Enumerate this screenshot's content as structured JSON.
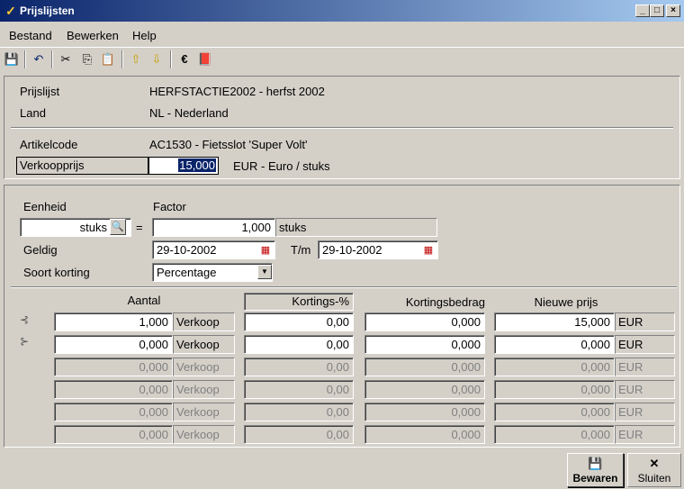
{
  "window": {
    "title": "Prijslijsten",
    "controls": [
      "_",
      "□",
      "×"
    ]
  },
  "menu": [
    "Bestand",
    "Bewerken",
    "Help"
  ],
  "toolbar": {
    "icons": [
      "save-icon",
      "undo-icon",
      "cut-icon",
      "copy-icon",
      "paste-icon",
      "arrow-up-icon",
      "arrow-down-icon",
      "euro-icon",
      "book-icon"
    ],
    "glyphs": [
      "💾",
      "↶",
      "✂",
      "⎘",
      "📋",
      "⇧",
      "⇩",
      "€",
      "📕"
    ]
  },
  "info": {
    "prijslijst_label": "Prijslijst",
    "prijslijst_value": "HERFSTACTIE2002 - herfst 2002",
    "land_label": "Land",
    "land_value": "NL - Nederland",
    "artikelcode_label": "Artikelcode",
    "artikelcode_value": "AC1530 - Fietsslot 'Super Volt'",
    "verkoopprijs_label": "Verkoopprijs",
    "verkoopprijs_value": "15,000",
    "verkoopprijs_unit": "EUR - Euro / stuks"
  },
  "detail": {
    "eenheid_label": "Eenheid",
    "eenheid_value": "stuks",
    "equals": "=",
    "factor_label": "Factor",
    "factor_value": "1,000",
    "factor_unit": "stuks",
    "geldig_label": "Geldig",
    "geldig_from": "29-10-2002",
    "tm_label": "T/m",
    "geldig_to": "29-10-2002",
    "soort_label": "Soort korting",
    "soort_value": "Percentage"
  },
  "table": {
    "headers": {
      "aantal": "Aantal",
      "korting_pct": "Kortings-%",
      "kortingsbedrag": "Kortingsbedrag",
      "nieuwe_prijs": "Nieuwe prijs"
    },
    "row_icons": [
      "⊰",
      "⊱"
    ],
    "rows": [
      {
        "aantal": "1,000",
        "type": "Verkoop",
        "pct": "0,00",
        "bedrag": "0,000",
        "prijs": "15,000",
        "cur": "EUR",
        "enabled": true
      },
      {
        "aantal": "0,000",
        "type": "Verkoop",
        "pct": "0,00",
        "bedrag": "0,000",
        "prijs": "0,000",
        "cur": "EUR",
        "enabled": true
      },
      {
        "aantal": "0,000",
        "type": "Verkoop",
        "pct": "0,00",
        "bedrag": "0,000",
        "prijs": "0,000",
        "cur": "EUR",
        "enabled": false
      },
      {
        "aantal": "0,000",
        "type": "Verkoop",
        "pct": "0,00",
        "bedrag": "0,000",
        "prijs": "0,000",
        "cur": "EUR",
        "enabled": false
      },
      {
        "aantal": "0,000",
        "type": "Verkoop",
        "pct": "0,00",
        "bedrag": "0,000",
        "prijs": "0,000",
        "cur": "EUR",
        "enabled": false
      },
      {
        "aantal": "0,000",
        "type": "Verkoop",
        "pct": "0,00",
        "bedrag": "0,000",
        "prijs": "0,000",
        "cur": "EUR",
        "enabled": false
      }
    ]
  },
  "buttons": {
    "bewaren_label": "Bewaren",
    "bewaren_icon": "💾",
    "sluiten_label": "Sluiten",
    "sluiten_icon": "✕"
  }
}
